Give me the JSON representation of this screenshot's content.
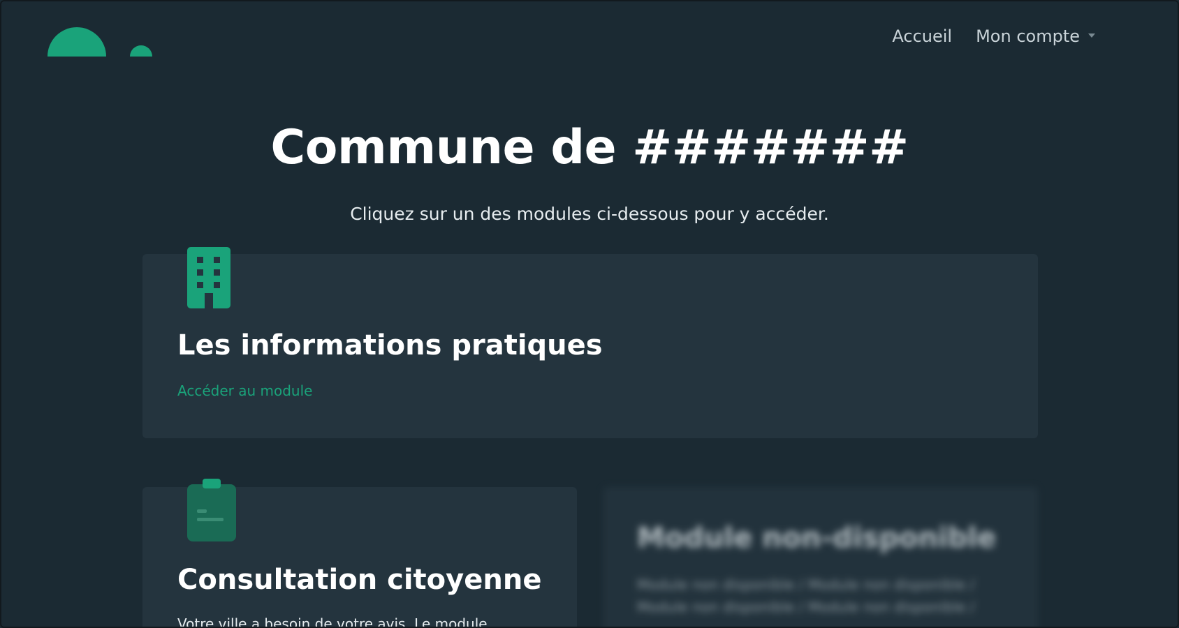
{
  "colors": {
    "background": "#1b2a33",
    "card": "#24343e",
    "accent": "#1aa37a",
    "text": "#ffffff",
    "nav_text": "#c9d3d8"
  },
  "header": {
    "logo_icon": "semicircle-logo",
    "nav": {
      "home_label": "Accueil",
      "account_label": "Mon compte"
    }
  },
  "hero": {
    "title": "Commune de #######",
    "subtitle": "Cliquez sur un des modules ci-dessous pour y accéder."
  },
  "modules": {
    "info": {
      "icon": "building-icon",
      "title": "Les informations pratiques",
      "link": "Accéder au module"
    },
    "consultation": {
      "icon": "clipboard-icon",
      "title": "Consultation citoyenne",
      "description": "Votre ville a besoin de votre avis. Le module"
    },
    "unavailable": {
      "title": "Module non-disponible",
      "line1": "Module non disponible / Module non disponible /",
      "line2": "Module non disponible / Module non disponible /"
    }
  }
}
